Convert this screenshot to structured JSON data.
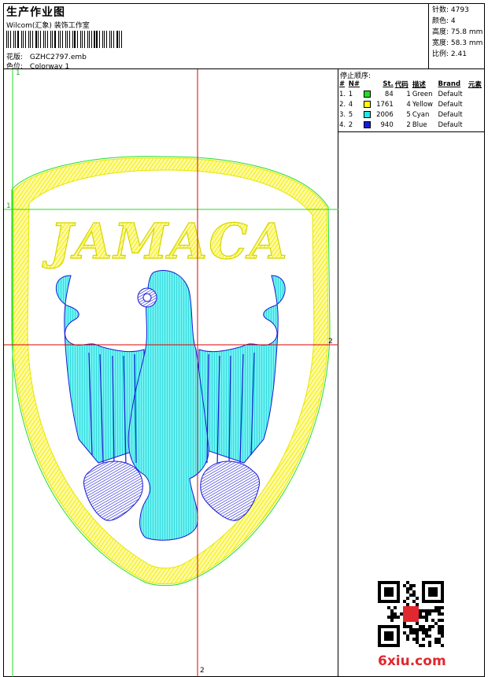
{
  "header": {
    "title": "生产作业图",
    "company": "Wilcom(汇象) 装饰工作室",
    "design_label": "花版:",
    "design_value": "GZHC2797.emb",
    "colorway_label": "色位:",
    "colorway_value": "Colorway 1"
  },
  "stats": [
    {
      "label": "针数:",
      "value": "4793"
    },
    {
      "label": "颜色:",
      "value": "4"
    },
    {
      "label": "高度:",
      "value": "75.8 mm"
    },
    {
      "label": "宽度:",
      "value": "58.3 mm"
    },
    {
      "label": "比例:",
      "value": "2.41"
    }
  ],
  "sequence": {
    "title": "停止顺序:",
    "columns": [
      "#",
      "N#",
      "St.",
      "代码",
      "描述",
      "Brand",
      "元素"
    ],
    "rows": [
      {
        "num": "1.",
        "n": "1",
        "color": "#22dd22",
        "st": "84",
        "code": "1",
        "desc": "Green",
        "brand": "Default"
      },
      {
        "num": "2.",
        "n": "4",
        "color": "#ffff00",
        "st": "1761",
        "code": "4",
        "desc": "Yellow",
        "brand": "Default"
      },
      {
        "num": "3.",
        "n": "5",
        "color": "#22e6e6",
        "st": "2006",
        "code": "5",
        "desc": "Cyan",
        "brand": "Default"
      },
      {
        "num": "4.",
        "n": "2",
        "color": "#1a1ad6",
        "st": "940",
        "code": "2",
        "desc": "Blue",
        "brand": "Default"
      }
    ]
  },
  "design": {
    "lettering": "JAMACA",
    "markers": {
      "v1": "1",
      "h1": "1",
      "h2": "2",
      "v2": "2"
    },
    "colors": {
      "green": "#22dd22",
      "yellow": "#f0f000",
      "cyan": "#22e6e6",
      "blue": "#1a1ad6",
      "red": "#dd0000"
    }
  },
  "watermark": {
    "logo": "6xiu.com"
  }
}
